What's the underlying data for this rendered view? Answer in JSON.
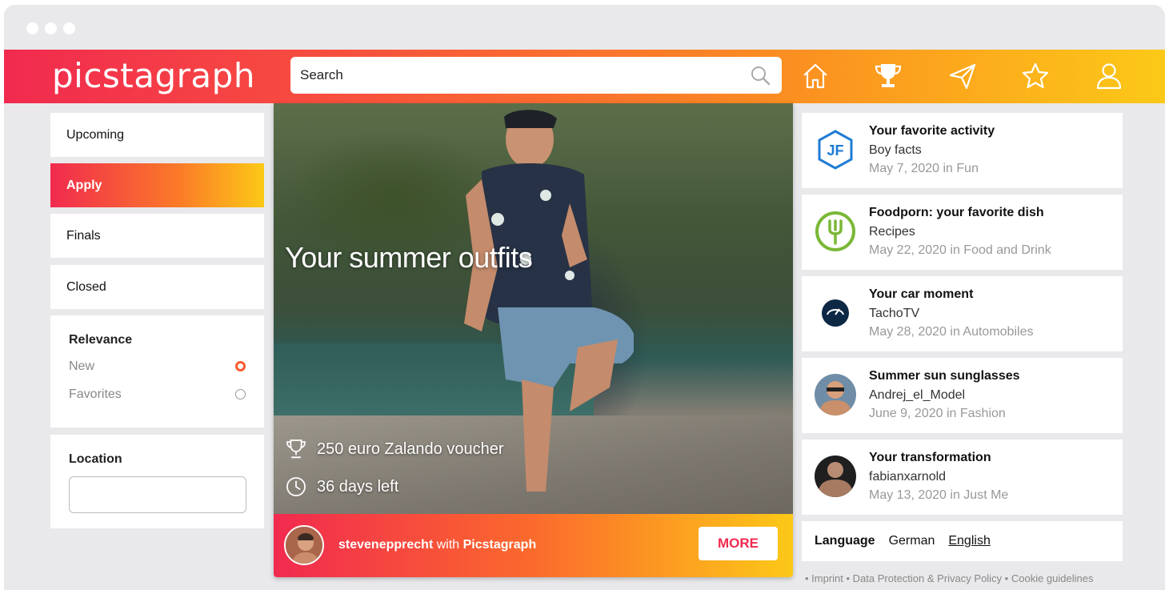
{
  "app": {
    "logo": "picstagraph"
  },
  "search": {
    "placeholder": "Search"
  },
  "nav": {
    "icons": [
      "home-icon",
      "trophy-icon",
      "send-icon",
      "star-icon",
      "user-icon"
    ]
  },
  "sidebar": {
    "tabs": [
      {
        "label": "Upcoming",
        "active": false
      },
      {
        "label": "Apply",
        "active": true
      },
      {
        "label": "Finals",
        "active": false
      },
      {
        "label": "Closed",
        "active": false
      }
    ],
    "relevance": {
      "title": "Relevance",
      "options": [
        {
          "label": "New",
          "selected": true
        },
        {
          "label": "Favorites",
          "selected": false
        }
      ]
    },
    "location": {
      "title": "Location",
      "value": ""
    }
  },
  "feature": {
    "title": "Your summer outfits",
    "prize": "250 euro Zalando voucher",
    "time_left": "36 days left",
    "author": "stevenepprecht",
    "with_text": "with",
    "partner": "Picstagraph",
    "more_label": "MORE"
  },
  "challenges": [
    {
      "title": "Your favorite activity",
      "sub": "Boy facts",
      "date": "May 7, 2020 in Fun",
      "icon": "jf-badge-icon"
    },
    {
      "title": "Foodporn: your favorite dish",
      "sub": "Recipes",
      "date": "May 22, 2020 in Food and Drink",
      "icon": "fork-icon"
    },
    {
      "title": "Your car moment",
      "sub": "TachoTV",
      "date": "May 28, 2020 in Automobiles",
      "icon": "tacho-logo-icon"
    },
    {
      "title": "Summer sun sunglasses",
      "sub": "Andrej_el_Model",
      "date": "June 9, 2020 in Fashion",
      "icon": "avatar-icon"
    },
    {
      "title": "Your transformation",
      "sub": "fabianxarnold",
      "date": "May 13, 2020 in Just Me",
      "icon": "avatar-icon"
    }
  ],
  "language": {
    "label": "Language",
    "options": [
      "German",
      "English"
    ],
    "selected": "English"
  },
  "footer": "• Imprint • Data Protection & Privacy Policy • Cookie guidelines",
  "colors": {
    "gradient_start": "#f12a4f",
    "gradient_mid": "#fb8a22",
    "gradient_end": "#fcc917"
  }
}
